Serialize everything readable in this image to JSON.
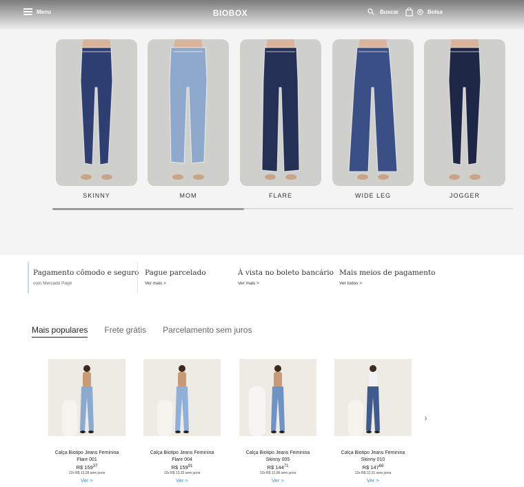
{
  "header": {
    "menu_label": "Menu",
    "logo": "BIOBOX",
    "search_label": "Buscar",
    "bag_label": "Bolsa",
    "bag_count": "0"
  },
  "categories": [
    {
      "label": "SKINNY",
      "color": "#2f3f72"
    },
    {
      "label": "MOM",
      "color": "#8ea9cc"
    },
    {
      "label": "FLARE",
      "color": "#253056"
    },
    {
      "label": "WIDE LEG",
      "color": "#3a4f86"
    },
    {
      "label": "JOGGER",
      "color": "#1f2746"
    }
  ],
  "payments": [
    {
      "title": "Pagamento cômodo e seguro",
      "sub": "com Mercado Pago"
    },
    {
      "title": "Pague parcelado",
      "sub": "Ver mais >"
    },
    {
      "title": "À vista no boleto bancário",
      "sub": "Ver mais >"
    },
    {
      "title": "Mais meios de pagamento",
      "sub": "Ver todos >"
    }
  ],
  "tabs": [
    "Mais populares",
    "Frete grátis",
    "Parcelamento sem juros"
  ],
  "products": [
    {
      "name_line1": "Calça Biotipo Jeans Feminina",
      "name_line2": "Flare 001",
      "price": "R$ 159",
      "cents": "37",
      "installments": "12x R$ 13,28 sem juros",
      "link": "Ver >",
      "jean_color": "#8aaad0"
    },
    {
      "name_line1": "Calça Biotipo Jeans Feminina",
      "name_line2": "Flare 004",
      "price": "R$ 159",
      "cents": "91",
      "installments": "12x R$ 13,33 sem juros",
      "link": "Ver >",
      "jean_color": "#8eb0d8"
    },
    {
      "name_line1": "Calça Biotipo Jeans Feminina",
      "name_line2": "Skinny 005",
      "price": "R$ 144",
      "cents": "71",
      "installments": "12x R$ 12,06 sem juros",
      "link": "Ver >",
      "jean_color": "#6f93c4"
    },
    {
      "name_line1": "Calça Biotipo Jeans Feminina",
      "name_line2": "Skinny 010",
      "price": "R$ 147",
      "cents": "68",
      "installments": "12x R$ 12,31 sem juros",
      "link": "Ver >",
      "jean_color": "#3f5a8c"
    }
  ],
  "icons": {
    "menu": "hamburger-icon",
    "search": "search-icon",
    "bag": "shopping-bag-icon",
    "next": "chevron-right-icon"
  }
}
